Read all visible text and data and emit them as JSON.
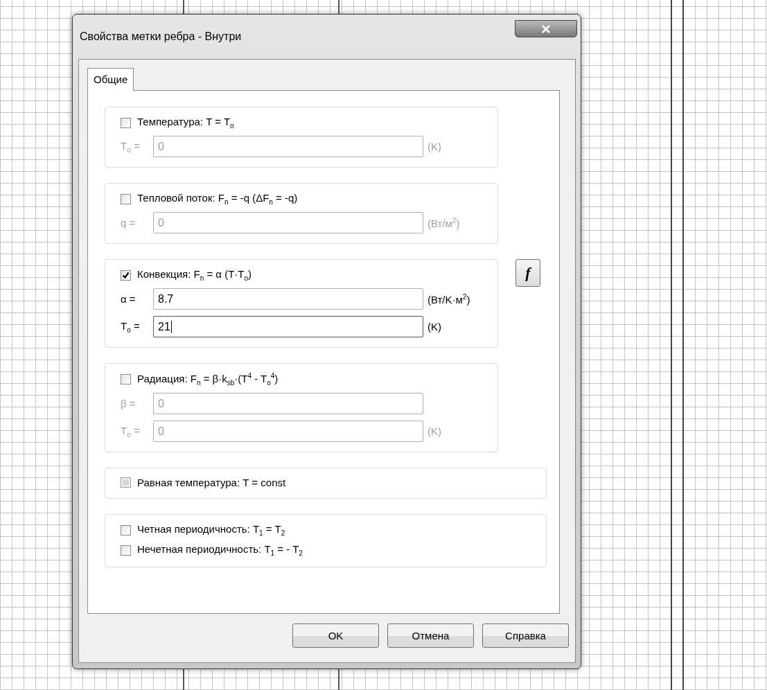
{
  "window": {
    "title": "Свойства метки ребра - Внутри"
  },
  "tabs": [
    {
      "label": "Общие",
      "selected": true
    }
  ],
  "groups": [
    {
      "kind": "fields",
      "wide": false,
      "checkboxes": [
        {
          "label": "Температура: T = T$_{o}$",
          "checked": false,
          "disabled": false
        }
      ],
      "fields": [
        {
          "label": "T$_{o}$ =",
          "value": "0",
          "unit": "(K)",
          "disabled": true,
          "focused": false
        }
      ]
    },
    {
      "kind": "fields",
      "wide": false,
      "checkboxes": [
        {
          "label": "Тепловой поток: F$_{n}$ = -q (ΔF$_{n}$ = -q)",
          "checked": false,
          "disabled": false
        }
      ],
      "fields": [
        {
          "label": "q =",
          "value": "0",
          "unit": "(Вт/м$^{2}$)",
          "disabled": true,
          "focused": false
        }
      ]
    },
    {
      "kind": "fields",
      "wide": false,
      "side_button": "f",
      "checkboxes": [
        {
          "label": "Конвекция: F$_{n}$ = α (T·T$_{o}$)",
          "checked": true,
          "disabled": false
        }
      ],
      "fields": [
        {
          "label": "α =",
          "value": "8.7",
          "unit": "(Вт/K·м$^{2}$)",
          "disabled": false,
          "focused": false
        },
        {
          "label": "T$_{o}$ =",
          "value": "21",
          "unit": "(K)",
          "disabled": false,
          "focused": true
        }
      ]
    },
    {
      "kind": "fields",
      "wide": false,
      "checkboxes": [
        {
          "label": "Радиация: F$_{n}$ = β·k$_{sb}$·(T$^{4}$ - T$_{o}$$^{4}$)",
          "checked": false,
          "disabled": false
        }
      ],
      "fields": [
        {
          "label": "β =",
          "value": "0",
          "disabled": true,
          "focused": false
        },
        {
          "label": "T$_{o}$ =",
          "value": "0",
          "unit": "(K)",
          "disabled": true,
          "focused": false
        }
      ]
    },
    {
      "kind": "checks",
      "wide": true,
      "checkboxes": [
        {
          "label": "Равная температура: T = const",
          "checked": false,
          "disabled": true
        }
      ]
    },
    {
      "kind": "checks",
      "wide": true,
      "checkboxes": [
        {
          "label": "Четная периодичность: T$_{1}$ = T$_{2}$",
          "checked": false,
          "disabled": false
        },
        {
          "label": "Нечетная периодичность: T$_{1}$ = - T$_{2}$",
          "checked": false,
          "disabled": false
        }
      ]
    }
  ],
  "buttons": [
    "OK",
    "Отмена",
    "Справка"
  ]
}
